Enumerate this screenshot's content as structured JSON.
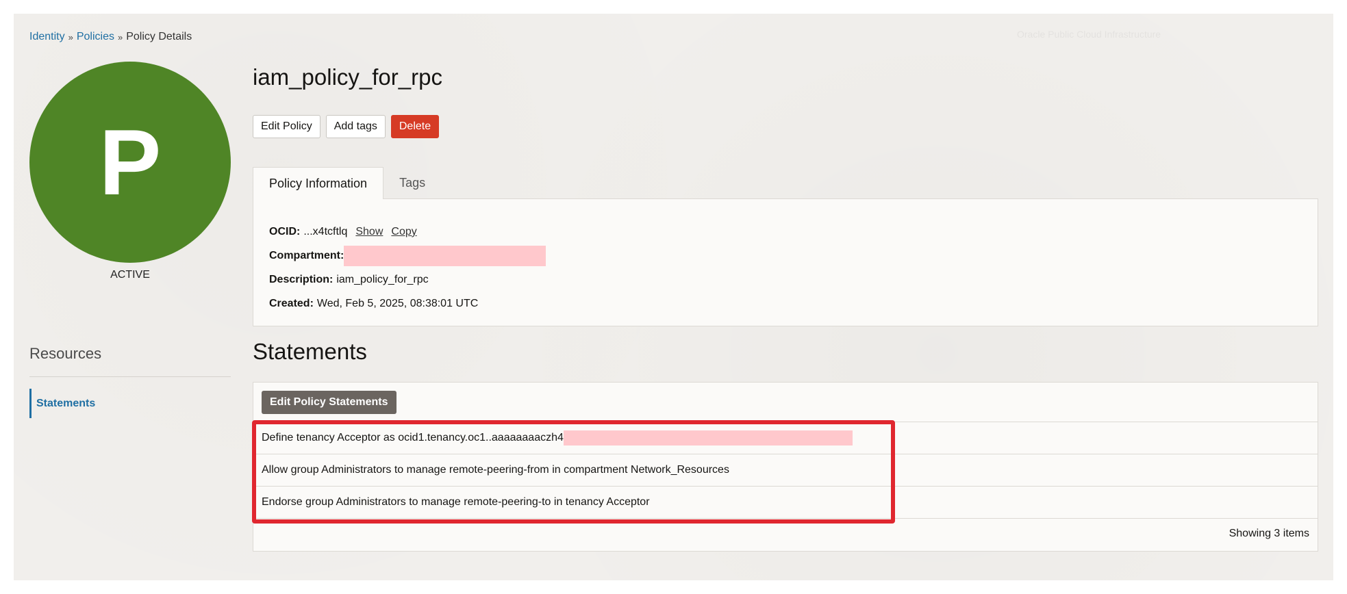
{
  "breadcrumb": {
    "items": [
      "Identity",
      "Policies"
    ],
    "current": "Policy Details",
    "separator": "»"
  },
  "watermark": "Oracle Public Cloud Infrastructure",
  "avatar": {
    "letter": "P",
    "color": "#4f8526"
  },
  "status": "ACTIVE",
  "resources": {
    "title": "Resources",
    "items": [
      {
        "label": "Statements"
      }
    ]
  },
  "policy": {
    "name": "iam_policy_for_rpc"
  },
  "actions": {
    "edit": "Edit Policy",
    "add_tags": "Add tags",
    "delete": "Delete"
  },
  "tabs": [
    {
      "label": "Policy Information",
      "active": true
    },
    {
      "label": "Tags",
      "active": false
    }
  ],
  "info": {
    "ocid_label": "OCID:",
    "ocid_value": "...x4tcftlq",
    "show_label": "Show",
    "copy_label": "Copy",
    "compartment_label": "Compartment:",
    "description_label": "Description:",
    "description_value": "iam_policy_for_rpc",
    "created_label": "Created:",
    "created_value": "Wed, Feb 5, 2025, 08:38:01 UTC"
  },
  "statements": {
    "title": "Statements",
    "edit_button": "Edit Policy Statements",
    "rows": [
      "Define tenancy Acceptor as ocid1.tenancy.oc1..aaaaaaaaczh4",
      "Allow group Administrators to manage remote-peering-from in compartment Network_Resources",
      "Endorse group Administrators to manage remote-peering-to in tenancy Acceptor"
    ],
    "count": "Showing 3 items"
  },
  "colors": {
    "accent": "#1f6fa3",
    "danger": "#d63b25",
    "highlight": "#e0272f",
    "redaction": "#ffc8cc"
  }
}
